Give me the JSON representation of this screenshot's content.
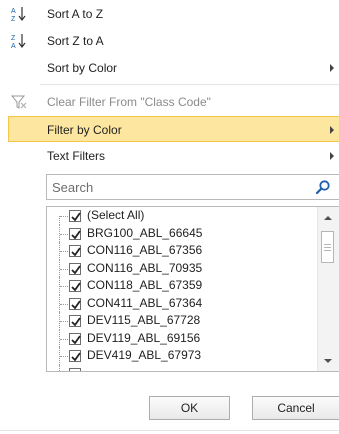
{
  "menu": {
    "sort_az": {
      "label": "Sort A to Z",
      "icon": "sort-a-to-z-icon"
    },
    "sort_za": {
      "label": "Sort Z to A",
      "icon": "sort-z-to-a-icon"
    },
    "sort_by_color": {
      "label": "Sort by Color",
      "has_submenu": true
    },
    "clear_filter": {
      "label": "Clear Filter From \"Class Code\"",
      "icon": "clear-filter-icon",
      "disabled": true
    },
    "filter_by_color": {
      "label": "Filter by Color",
      "has_submenu": true,
      "highlighted": true
    },
    "text_filters": {
      "label": "Text Filters",
      "has_submenu": true
    }
  },
  "search": {
    "placeholder": "Search",
    "value": "",
    "icon": "search-icon"
  },
  "list": {
    "items": [
      {
        "label": "(Select All)",
        "checked": true
      },
      {
        "label": "BRG100_ABL_66645",
        "checked": true
      },
      {
        "label": "CON116_ABL_67356",
        "checked": true
      },
      {
        "label": "CON116_ABL_70935",
        "checked": true
      },
      {
        "label": "CON118_ABL_67359",
        "checked": true
      },
      {
        "label": "CON411_ABL_67364",
        "checked": true
      },
      {
        "label": "DEV115_ABL_67728",
        "checked": true
      },
      {
        "label": "DEV119_ABL_69156",
        "checked": true
      },
      {
        "label": "DEV419_ABL_67973",
        "checked": true
      }
    ]
  },
  "buttons": {
    "ok": "OK",
    "cancel": "Cancel"
  },
  "colors": {
    "highlight_bg": "#fde7a0",
    "highlight_border": "#f4c64e",
    "disabled_text": "#8a8a8a",
    "search_icon": "#1e5fa8"
  }
}
